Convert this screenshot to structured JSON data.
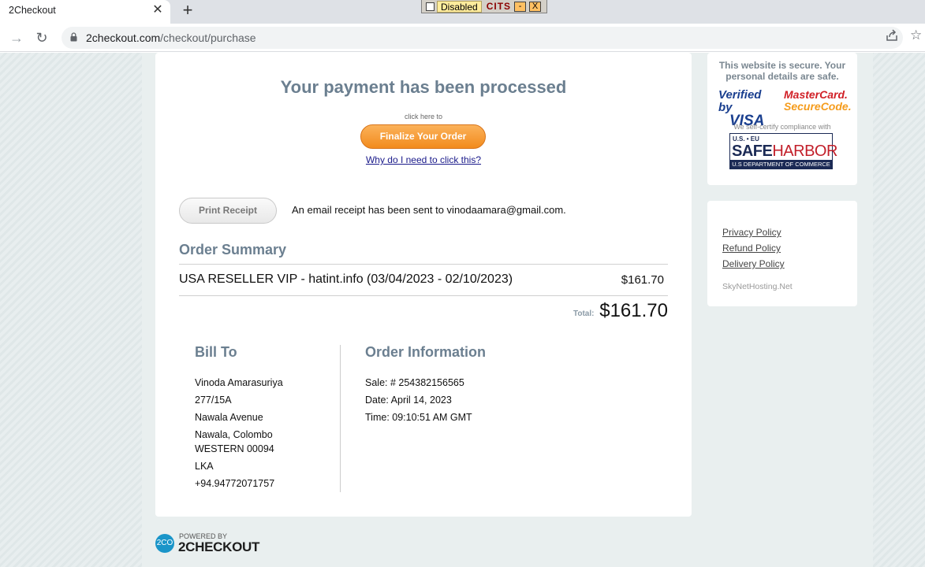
{
  "browser": {
    "tab_title": "2Checkout",
    "url_domain": "2checkout.com",
    "url_path": "/checkout/purchase"
  },
  "cits_widget": {
    "checkbox_label": "Disabled",
    "label": "CITS",
    "minimize": "-",
    "close": "X"
  },
  "main": {
    "heading": "Your payment has been processed",
    "click_here": "click here to",
    "finalize_button": "Finalize Your Order",
    "why_link": "Why do I need to click this?",
    "print_button": "Print Receipt",
    "email_note": "An email receipt has been sent to vinodaamara@gmail.com.",
    "order_summary_title": "Order Summary",
    "item": {
      "name": "USA RESELLER VIP - hatint.info (03/04/2023 - 02/10/2023)",
      "price": "$161.70"
    },
    "total_label": "Total:",
    "total_value": "$161.70"
  },
  "bill_to": {
    "title": "Bill To",
    "lines": [
      "Vinoda Amarasuriya",
      "277/15A",
      "Nawala Avenue",
      "Nawala, Colombo",
      "WESTERN 00094",
      "LKA",
      "+94.94772071757"
    ]
  },
  "order_info": {
    "title": "Order Information",
    "sale": "Sale: # 254382156565",
    "date": "Date: April 14, 2023",
    "time": "Time: 09:10:51 AM GMT"
  },
  "security_panel": {
    "secure_text": "This website is secure. Your personal details are safe.",
    "vbv_line1": "Verified by",
    "vbv_line2": "VISA",
    "mc_line1": "MasterCard.",
    "mc_line2": "SecureCode.",
    "self_certify": "We self-certify compliance with",
    "sh_top": "U.S. • EU",
    "sh_safe": "SAFE",
    "sh_harbor": "HARBOR",
    "sh_bottom": "U.S DEPARTMENT OF COMMERCE"
  },
  "policy_panel": {
    "links": [
      "Privacy Policy",
      "Refund Policy",
      "Delivery Policy"
    ],
    "brand": "SkyNetHosting.Net"
  },
  "footer": {
    "logo_text": "2CO",
    "powered_by": "POWERED BY",
    "brand": "2CHECKOUT"
  },
  "colors": {
    "heading": "#6b7f90",
    "button_orange": "#f28b1d",
    "link_blue": "#1a1a8a",
    "twoco_blue": "#1a95c9"
  }
}
